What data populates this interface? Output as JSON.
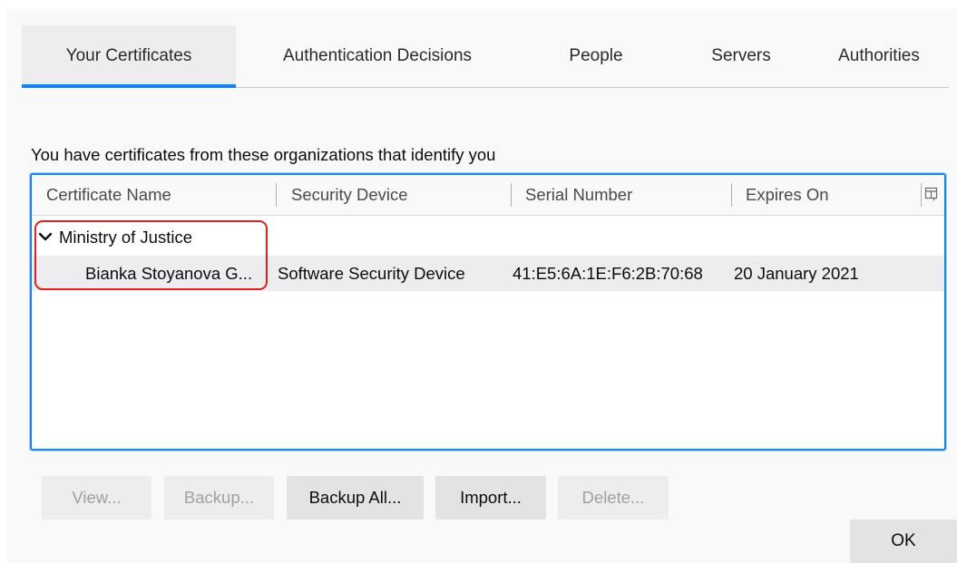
{
  "tabs": [
    {
      "label": "Your Certificates",
      "selected": true
    },
    {
      "label": "Authentication Decisions",
      "selected": false
    },
    {
      "label": "People",
      "selected": false
    },
    {
      "label": "Servers",
      "selected": false
    },
    {
      "label": "Authorities",
      "selected": false
    }
  ],
  "heading": "You have certificates from these organizations that identify you",
  "table": {
    "columns": [
      "Certificate Name",
      "Security Device",
      "Serial Number",
      "Expires On"
    ],
    "column_picker_icon": "column-picker-icon",
    "groups": [
      {
        "name": "Ministry of Justice",
        "expanded": true,
        "rows": [
          {
            "certificate_name": "Bianka Stoyanova G...",
            "security_device": "Software Security Device",
            "serial_number": "41:E5:6A:1E:F6:2B:70:68",
            "expires_on": "20 January 2021"
          }
        ]
      }
    ]
  },
  "buttons": {
    "view": "View...",
    "backup": "Backup...",
    "backup_all": "Backup All...",
    "import": "Import...",
    "delete": "Delete...",
    "ok": "OK"
  },
  "colors": {
    "accent": "#0a84ff",
    "highlight": "#e0201f"
  }
}
